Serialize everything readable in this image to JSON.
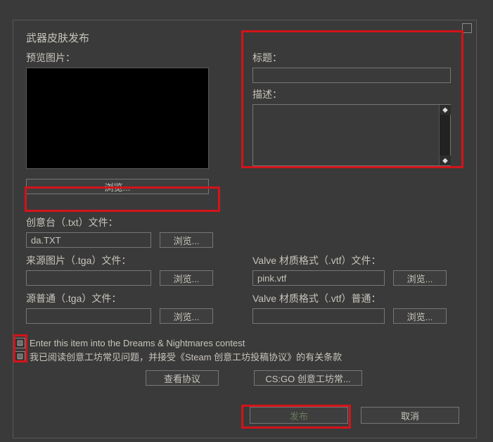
{
  "window": {
    "title": "武器皮肤发布"
  },
  "preview": {
    "label": "预览图片：",
    "browse": "浏览..."
  },
  "right_panel": {
    "title_label": "标题：",
    "title_value": "",
    "desc_label": "描述："
  },
  "txt_file": {
    "label": "创意台（.txt）文件：",
    "value": "da.TXT",
    "browse": "浏览..."
  },
  "source_tga": {
    "label": "来源图片（.tga）文件：",
    "value": "",
    "browse": "浏览..."
  },
  "normal_tga": {
    "label": "源普通（.tga）文件：",
    "value": "",
    "browse": "浏览..."
  },
  "vtf_file": {
    "label": "Valve 材质格式（.vtf）文件：",
    "value": "pink.vtf",
    "browse": "浏览..."
  },
  "vtf_normal": {
    "label": "Valve 材质格式（.vtf）普通：",
    "value": "",
    "browse": "浏览..."
  },
  "checks": {
    "contest": "Enter this item into the Dreams & Nightmares contest",
    "agreement": "我已阅读创意工坊常见问题，并接受《Steam 创意工坊投稿协议》的有关条款"
  },
  "buttons": {
    "view_agreement": "查看协议",
    "faq": "CS:GO 创意工坊常...",
    "publish": "发布",
    "cancel": "取消"
  },
  "icons": {
    "checkbox_glyph": "▧",
    "scroll_up": "◆",
    "scroll_down": "◆"
  }
}
